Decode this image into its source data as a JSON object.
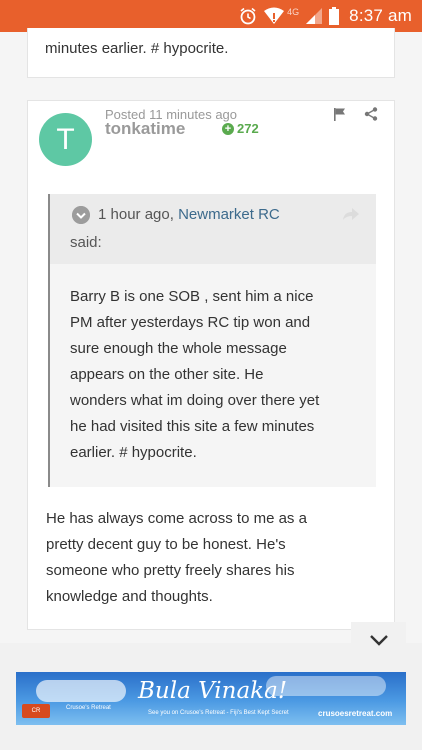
{
  "status_bar": {
    "network": "4G",
    "time": "8:37 am"
  },
  "previous_post": {
    "tail_text": "minutes earlier. # hypocrite."
  },
  "post": {
    "avatar_letter": "T",
    "avatar_color": "#5ec8a4",
    "posted": "Posted 11 minutes ago",
    "username": "tonkatime",
    "reputation": "272",
    "quote": {
      "time": "1 hour ago, ",
      "author": "Newmarket RC",
      "said": "said:",
      "body": "Barry B is one SOB , sent him a nice\nPM after yesterdays RC tip won and\nsure enough the whole message\nappears on the other site. He\nwonders what im doing over there yet\nhe had visited this site a few minutes\nearlier. # hypocrite."
    },
    "reply": "He has always come across to me as a\npretty decent guy to be honest. He's\nsomeone who pretty freely shares his\nknowledge and thoughts."
  },
  "ad": {
    "headline": "Bula Vinaka!",
    "brand": "Crusoe's Retreat",
    "tagline": "See you on Crusoe's Retreat - Fiji's Best Kept Secret",
    "site": "crusoesretreat.com",
    "logo_text": "CR"
  }
}
